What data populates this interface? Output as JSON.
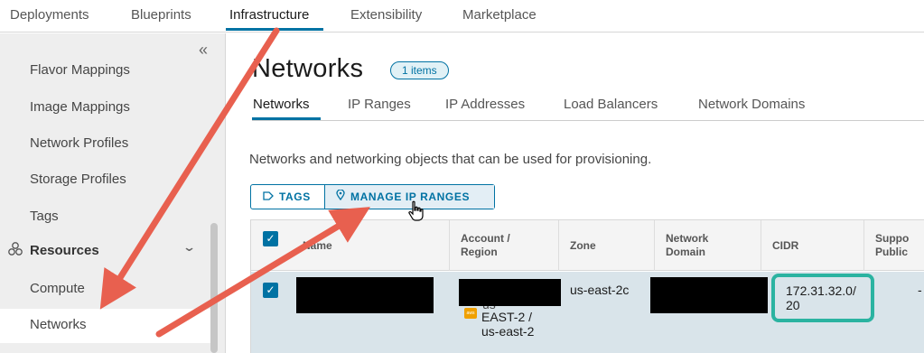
{
  "topnav": {
    "tabs": [
      {
        "label": "Deployments"
      },
      {
        "label": "Blueprints"
      },
      {
        "label": "Infrastructure"
      },
      {
        "label": "Extensibility"
      },
      {
        "label": "Marketplace"
      }
    ],
    "active_tab": "Infrastructure"
  },
  "sidebar": {
    "collapse_glyph": "«",
    "items": [
      {
        "label": "Flavor Mappings"
      },
      {
        "label": "Image Mappings"
      },
      {
        "label": "Network Profiles"
      },
      {
        "label": "Storage Profiles"
      },
      {
        "label": "Tags"
      }
    ],
    "group": {
      "label": "Resources",
      "icon": "resources-icon"
    },
    "group_items": [
      {
        "label": "Compute"
      },
      {
        "label": "Networks"
      }
    ],
    "selected_item": "Networks"
  },
  "main": {
    "title": "Networks",
    "count_badge": "1 items",
    "subtabs": [
      {
        "label": "Networks"
      },
      {
        "label": "IP Ranges"
      },
      {
        "label": "IP Addresses"
      },
      {
        "label": "Load Balancers"
      },
      {
        "label": "Network Domains"
      }
    ],
    "active_subtab": "Networks",
    "description": "Networks and networking objects that can be used for provisioning.",
    "actions": {
      "tags_label": "TAGS",
      "manage_label": "MANAGE IP RANGES"
    }
  },
  "table": {
    "columns": [
      {
        "label": "Name"
      },
      {
        "label": "Account /\nRegion"
      },
      {
        "label": "Zone"
      },
      {
        "label": "Network\nDomain"
      },
      {
        "label": "CIDR"
      },
      {
        "label": "Suppo\nPublic"
      }
    ],
    "rows": [
      {
        "name": "",
        "account_region_line1": "us-",
        "account_region_line2": "EAST-2 /",
        "account_region_line3": "us-east-2",
        "zone": "us-east-2c",
        "network_domain": "",
        "cidr_line1": "172.31.32.0/",
        "cidr_line2": "20",
        "support_public": "-",
        "selected": true
      }
    ]
  },
  "annotation": {
    "arrow_color": "#e8604f",
    "highlight_color": "#2bb3a1"
  }
}
